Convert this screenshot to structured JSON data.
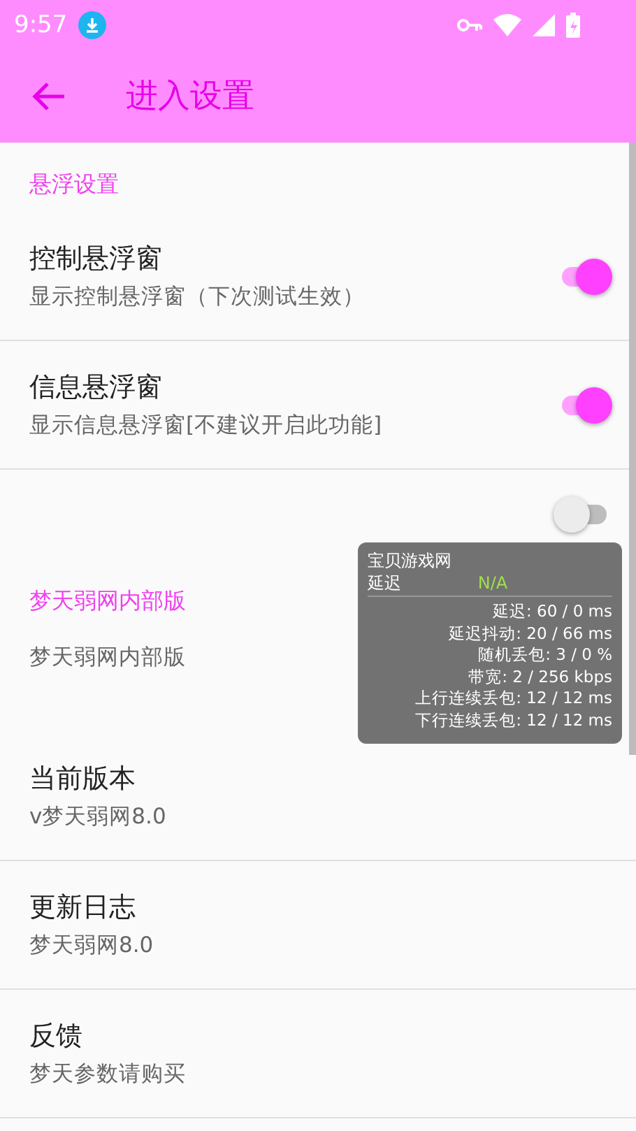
{
  "status_bar": {
    "time": "9:57"
  },
  "toolbar": {
    "title": "进入设置"
  },
  "preferences": [
    {
      "kind": "category",
      "title": "悬浮设置"
    },
    {
      "kind": "switch",
      "title": "控制悬浮窗",
      "summary": "显示控制悬浮窗（下次测试生效）",
      "on": true
    },
    {
      "kind": "switch",
      "title": "信息悬浮窗",
      "summary": "显示信息悬浮窗[不建议开启此功能]",
      "on": true
    },
    {
      "kind": "switch",
      "on": false
    },
    {
      "kind": "category",
      "title": "梦天弱网内部版"
    },
    {
      "kind": "info",
      "summary": "梦天弱网内部版"
    },
    {
      "kind": "info",
      "title": "当前版本",
      "summary": "v梦天弱网8.0"
    },
    {
      "kind": "info",
      "title": "更新日志",
      "summary": "梦天弱网8.0"
    },
    {
      "kind": "info",
      "title": "反馈",
      "summary": "梦天参数请购买"
    }
  ],
  "floating_window": {
    "title": "宝贝游戏网",
    "label": "延迟",
    "value": "N/A",
    "stats": [
      "延迟: 60 / 0 ms",
      "延迟抖动: 20 / 66 ms",
      "随机丢包: 3 / 0 %",
      "带宽: 2 / 256 kbps",
      "上行连续丢包: 12 / 12 ms",
      "下行连续丢包: 12 / 12 ms"
    ]
  }
}
